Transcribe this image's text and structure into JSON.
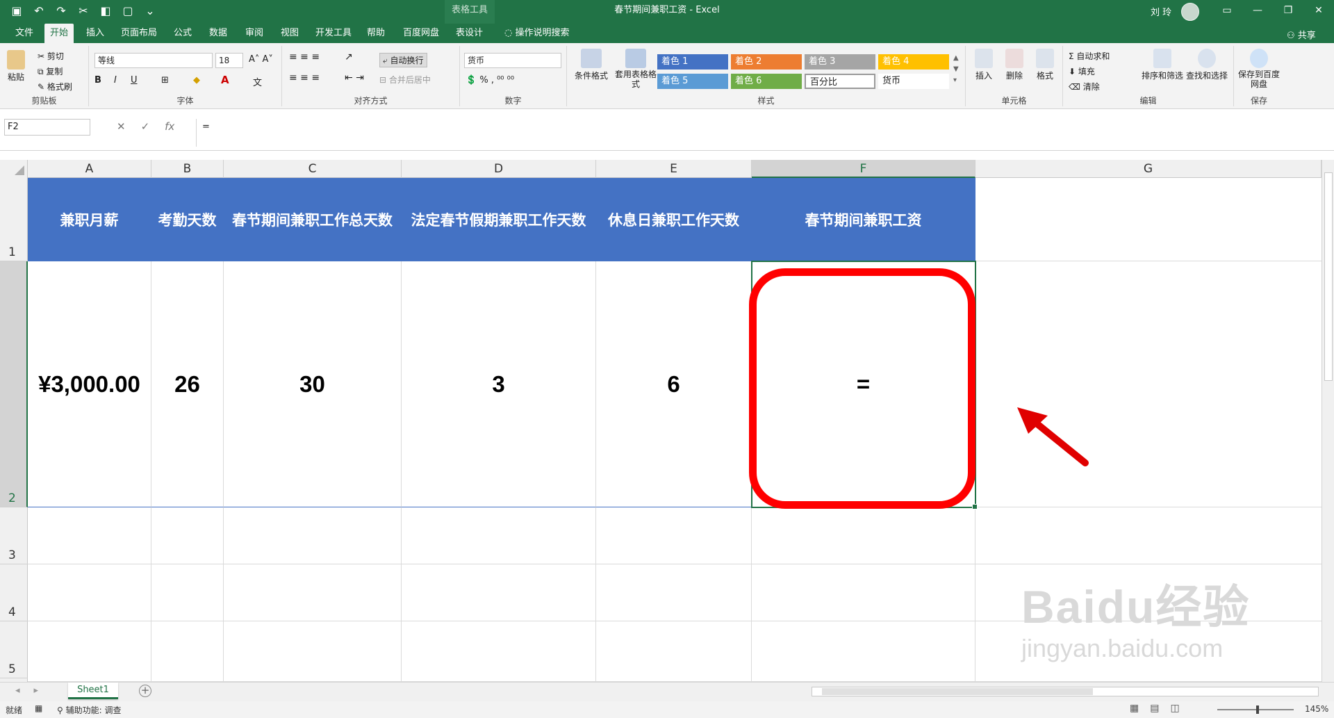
{
  "titlebar": {
    "context_tab": "表格工具",
    "document_title": "春节期间兼职工资  -  Excel",
    "user": "刘 玲"
  },
  "ribbon_tabs": [
    "文件",
    "开始",
    "插入",
    "页面布局",
    "公式",
    "数据",
    "审阅",
    "视图",
    "开发工具",
    "帮助",
    "百度网盘",
    "表设计",
    "操作说明搜索"
  ],
  "share_label": "共享",
  "ribbon": {
    "clipboard": {
      "paste": "粘贴",
      "cut": "剪切",
      "copy": "复制",
      "format_painter": "格式刷",
      "label": "剪贴板"
    },
    "font": {
      "name": "等线",
      "size": "18",
      "label": "字体"
    },
    "alignment": {
      "wrap": "自动换行",
      "merge": "合并后居中",
      "label": "对齐方式"
    },
    "number": {
      "format": "货币",
      "label": "数字"
    },
    "styles": {
      "conditional": "条件格式",
      "table_format": "套用表格格式",
      "cells": [
        {
          "text": "着色 1",
          "color": "#4472c4"
        },
        {
          "text": "着色 2",
          "color": "#ed7d31"
        },
        {
          "text": "着色 3",
          "color": "#a5a5a5"
        },
        {
          "text": "着色 4",
          "color": "#ffc000"
        },
        {
          "text": "着色 5",
          "color": "#5b9bd5"
        },
        {
          "text": "着色 6",
          "color": "#70ad47"
        },
        {
          "text": "百分比",
          "color": "#ffffff"
        },
        {
          "text": "货币",
          "color": "#ffffff"
        }
      ],
      "label": "样式"
    },
    "cells": {
      "insert": "插入",
      "delete": "删除",
      "format": "格式",
      "label": "单元格"
    },
    "editing": {
      "autosum": "自动求和",
      "fill": "填充",
      "clear": "清除",
      "sort": "排序和筛选",
      "find": "查找和选择",
      "label": "编辑"
    },
    "save": {
      "button": "保存到百度网盘",
      "label": "保存"
    }
  },
  "formula_bar": {
    "name_box": "F2",
    "formula": "="
  },
  "columns": [
    "A",
    "B",
    "C",
    "D",
    "E",
    "F",
    "G"
  ],
  "rows": [
    "1",
    "2",
    "3",
    "4",
    "5"
  ],
  "table": {
    "headers": [
      "兼职月薪",
      "考勤天数",
      "春节期间兼职工作总天数",
      "法定春节假期兼职工作天数",
      "休息日兼职工作天数",
      "春节期间兼职工资"
    ],
    "values": [
      "¥3,000.00",
      "26",
      "30",
      "3",
      "6",
      "="
    ]
  },
  "sheet_tab": "Sheet1",
  "status": {
    "ready": "就绪",
    "accessibility": "辅助功能: 调查",
    "zoom": "145%"
  },
  "watermark": {
    "big": "Baidu经验",
    "small": "jingyan.baidu.com"
  }
}
